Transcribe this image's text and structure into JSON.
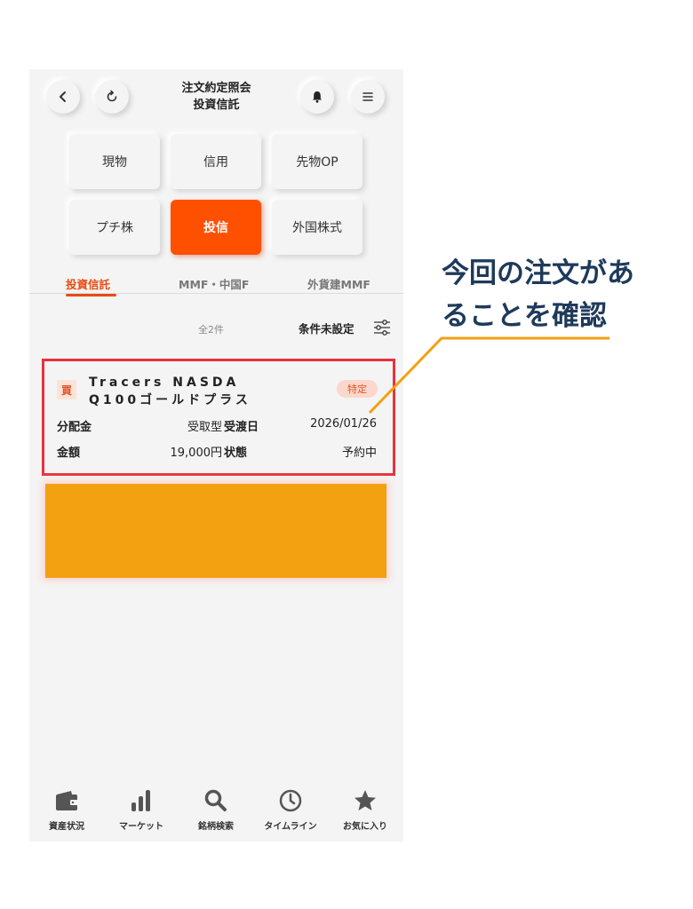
{
  "header": {
    "title_line1": "注文約定照会",
    "title_line2": "投資信託",
    "icons": [
      "back-icon",
      "refresh-icon",
      "bell-icon",
      "menu-icon"
    ]
  },
  "categories": [
    {
      "label": "現物",
      "active": false
    },
    {
      "label": "信用",
      "active": false
    },
    {
      "label": "先物OP",
      "active": false
    },
    {
      "label": "プチ株",
      "active": false
    },
    {
      "label": "投信",
      "active": true
    },
    {
      "label": "外国株式",
      "active": false
    }
  ],
  "tabs": [
    {
      "label": "投資信託",
      "active": true
    },
    {
      "label": "MMF・中国F",
      "active": false
    },
    {
      "label": "外貨建MMF",
      "active": false
    }
  ],
  "list": {
    "count": "全2件",
    "filter_label": "条件未設定"
  },
  "order": {
    "side": "買",
    "fund_name_line1": "Tracers NASDA",
    "fund_name_line2": "Q100ゴールドプラス",
    "tax_badge": "特定",
    "dividend_label": "分配金",
    "dividend_value": "受取型",
    "delivery_label": "受渡日",
    "delivery_value": "2026/01/26",
    "amount_label": "金額",
    "amount_value": "19,000円",
    "status_label": "状態",
    "status_value": "予約中"
  },
  "bottom_nav": [
    {
      "label": "資産状況",
      "icon": "wallet-icon"
    },
    {
      "label": "マーケット",
      "icon": "bar-chart-icon"
    },
    {
      "label": "銘柄検索",
      "icon": "search-icon"
    },
    {
      "label": "タイムライン",
      "icon": "clock-icon"
    },
    {
      "label": "お気に入り",
      "icon": "star-icon"
    }
  ],
  "annotation": {
    "callout_line1": "今回の注文があ",
    "callout_line2": "ることを確認",
    "callout_color": "#1e3a5a",
    "highlight_color": "#e8323c",
    "line_color": "#f3a011"
  },
  "colors": {
    "accent": "#ff5000",
    "tab_active": "#e84b12",
    "background": "#f4f4f4"
  }
}
